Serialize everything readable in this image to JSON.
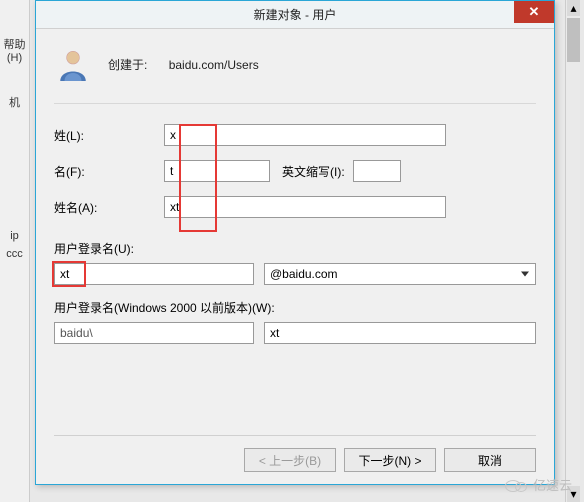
{
  "bg": {
    "help": "帮助(H)",
    "machine": "机",
    "ip": "ip",
    "cc": "ccc"
  },
  "dialog": {
    "title": "新建对象 - 用户",
    "created_in_label": "创建于:",
    "created_in_path": "baidu.com/Users",
    "surname_label": "姓(L):",
    "surname_value": "x",
    "given_label": "名(F):",
    "given_value": "t",
    "initials_label": "英文缩写(I):",
    "initials_value": "",
    "fullname_label": "姓名(A):",
    "fullname_value": "xt",
    "logon_label": "用户登录名(U):",
    "logon_value": "xt",
    "domain_selected": "@baidu.com",
    "logon_legacy_label": "用户登录名(Windows 2000 以前版本)(W):",
    "legacy_prefix": "baidu\\",
    "legacy_value": "xt",
    "back_btn": "< 上一步(B)",
    "next_btn": "下一步(N) >",
    "cancel_btn": "取消"
  },
  "watermark": "亿速云"
}
